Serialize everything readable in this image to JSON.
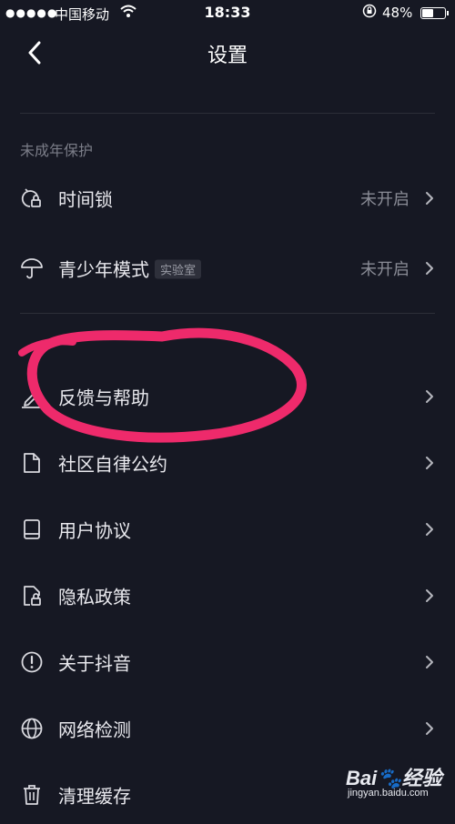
{
  "status_bar": {
    "signal": "●●●●●",
    "carrier": "中国移动",
    "time": "18:33",
    "battery_percent": "48%",
    "battery_level": 0.48
  },
  "nav": {
    "title": "设置",
    "back_icon": "chevron-left-icon"
  },
  "sections": {
    "minor_protection": {
      "header": "未成年保护",
      "items": [
        {
          "label": "时间锁",
          "value": "未开启",
          "icon": "time-lock-icon"
        },
        {
          "label": "青少年模式",
          "badge": "实验室",
          "value": "未开启",
          "icon": "umbrella-icon"
        }
      ]
    },
    "general": {
      "items": [
        {
          "label": "反馈与帮助",
          "icon": "pencil-icon"
        },
        {
          "label": "社区自律公约",
          "icon": "document-icon"
        },
        {
          "label": "用户协议",
          "icon": "book-icon"
        },
        {
          "label": "隐私政策",
          "icon": "privacy-lock-icon"
        },
        {
          "label": "关于抖音",
          "icon": "info-icon"
        },
        {
          "label": "网络检测",
          "icon": "globe-icon"
        },
        {
          "label": "清理缓存",
          "icon": "trash-icon"
        }
      ]
    }
  },
  "annotation": {
    "color": "#ee2a6b"
  },
  "watermark": {
    "logo": "Bai🐾经验",
    "url": "jingyan.baidu.com",
    "size": "1 M"
  },
  "colors": {
    "background": "#161823",
    "text": "#e9e9ee",
    "muted": "#8a8c96"
  }
}
